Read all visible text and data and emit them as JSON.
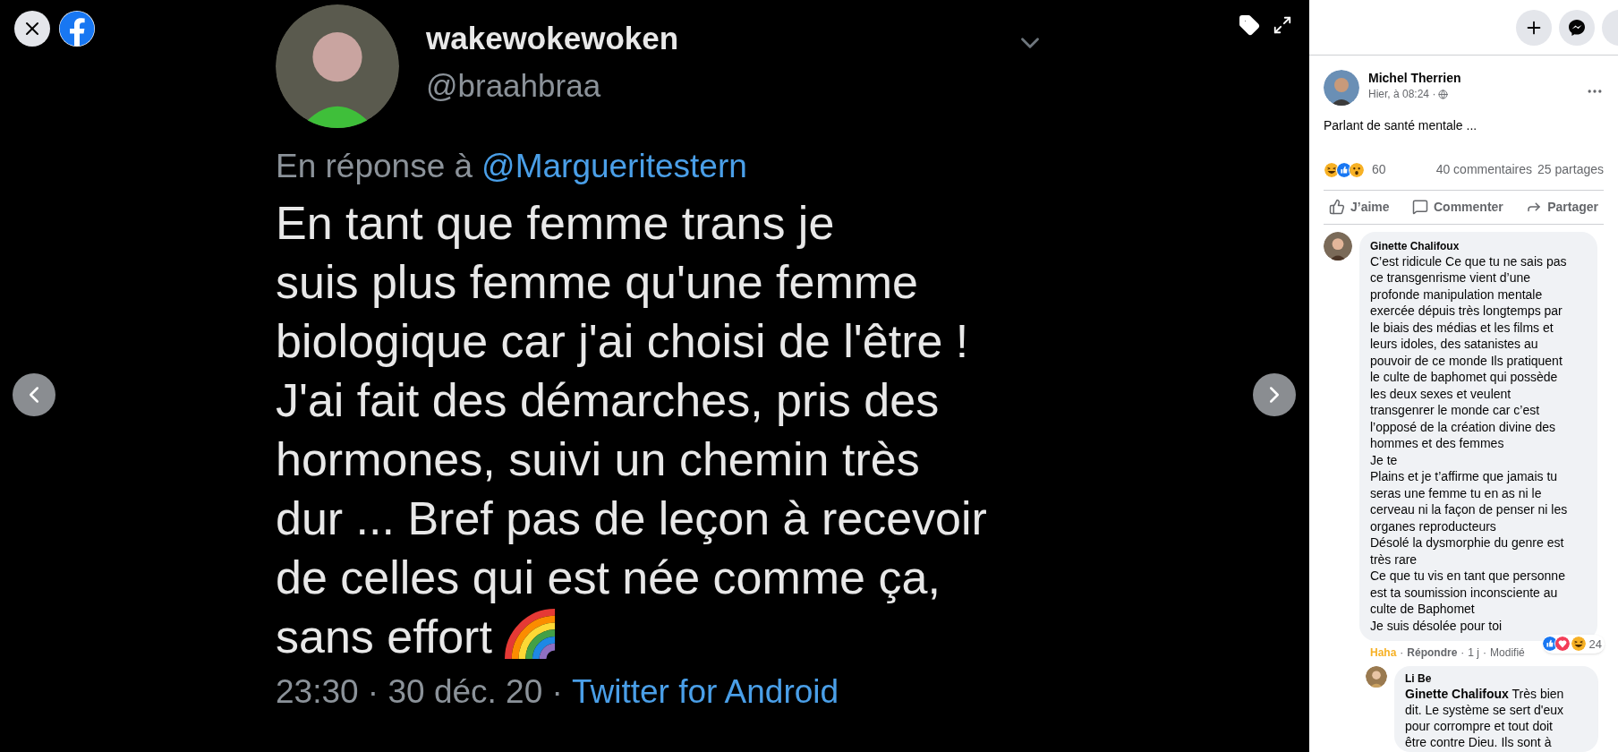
{
  "tweet": {
    "display_name": "wakewokewoken",
    "handle": "@braahbraa",
    "reply_prefix": "En réponse à",
    "reply_to": "@Margueritestern",
    "body_lines": [
      "En tant que femme trans je",
      "suis plus femme qu'une femme",
      "biologique car j'ai choisi de l'être !",
      "J'ai fait des démarches, pris des",
      "hormones, suivi un chemin très",
      "dur ... Bref pas de leçon à recevoir",
      "de celles qui est née comme ça,",
      "sans effort"
    ],
    "time": "23:30 · 30 déc. 20 ·",
    "source": "Twitter for Android"
  },
  "post": {
    "author": "Michel Therrien",
    "time": "Hier, à 08:24 ·",
    "text": "Parlant de santé mentale ...",
    "reaction_count": "60",
    "comments_count": "40 commentaires",
    "shares_count": "25 partages",
    "actions": [
      {
        "kind": "like",
        "label": "J’aime"
      },
      {
        "kind": "comment",
        "label": "Commenter"
      },
      {
        "kind": "share",
        "label": "Partager"
      }
    ]
  },
  "comments": [
    {
      "author": "Ginette Chalifoux",
      "text": "C’est ridicule Ce que tu ne sais pas\nce transgenrisme vient d’une\nprofonde manipulation mentale\nexercée dépuis très longtemps par\nle biais des médias et les films et\nleurs idoles, des satanistes au\npouvoir de ce monde Ils pratiquent\nle culte de baphomet qui possède\nles deux sexes et veulent\ntransgenrer le monde car c’est\nl’opposé de la création divine des\nhommes et des femmes\nJe te\nPlains et je t’affirme que jamais tu\nseras une femme tu en as ni le\ncerveau ni la façon de penser ni les\norganes reproducteurs\nDésolé la dysmorphie du genre est\ntrès rare\nCe que tu vis en tant que personne\nest ta soumission inconsciente au\nculte de Baphomet\nJe suis désolée pour toi",
      "my_reaction": "Haha",
      "separator": "·",
      "reply_label": "Répondre",
      "age": "1 j",
      "edited": "Modifié",
      "reaction_count": "24",
      "replies": [
        {
          "author": "Li Be",
          "text": "**Ginette Chalifoux** Très bien\ndit. Le système se sert d'eux\npour corrompre et tout doit\nêtre contre Dieu. Ils sont à"
        }
      ]
    }
  ]
}
